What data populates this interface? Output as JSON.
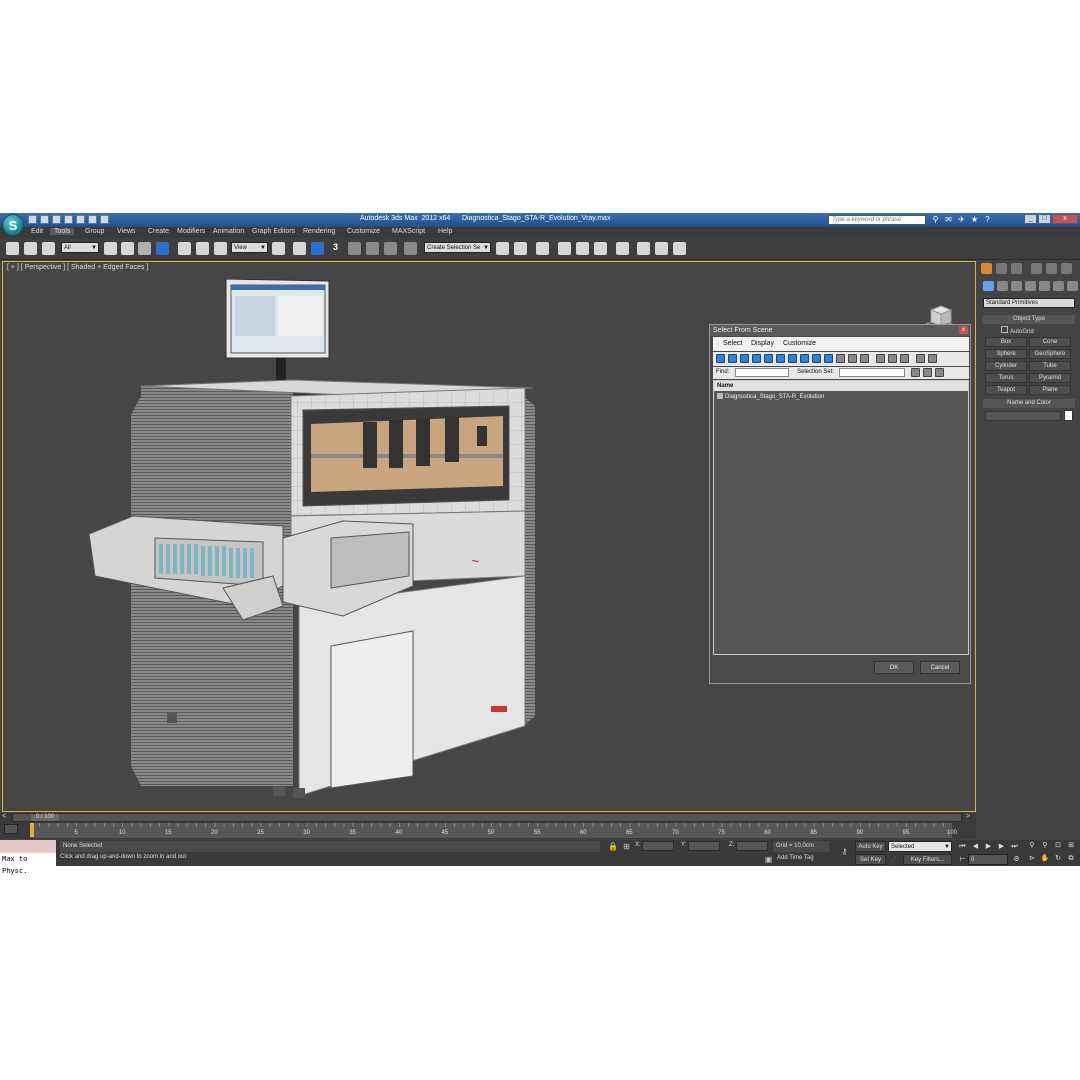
{
  "titlebar": {
    "app_logo_letter": "S",
    "title": "Autodesk 3ds Max  2012 x64      Diagnostica_Stago_STA-R_Evolution_Vray.max",
    "search_placeholder": "Type a keyword or phrase"
  },
  "menu": [
    "Edit",
    "Tools",
    "Group",
    "Views",
    "Create",
    "Modifiers",
    "Animation",
    "Graph Editors",
    "Rendering",
    "Customize",
    "MAXScript",
    "Help"
  ],
  "toolbar": {
    "selection_filter": "All",
    "reference_coord": "View",
    "snap_label": "3",
    "named_selection": "Create Selection Se"
  },
  "viewport": {
    "label": "[ + ] [ Perspective ] [ Shaded + Edged Faces ]"
  },
  "dialog": {
    "title": "Select From Scene",
    "close": "x",
    "menu": [
      "Select",
      "Display",
      "Customize"
    ],
    "find_label": "Find:",
    "selection_set_label": "Selection Set:",
    "list_header": "Name",
    "items": [
      "Diagnostica_Stago_STA-R_Evolution"
    ],
    "ok_label": "OK",
    "cancel_label": "Cancel"
  },
  "command_panel": {
    "primitive_type": "Standard Primitives",
    "object_type_title": "Object Type",
    "autogrid_label": "AutoGrid",
    "primitives": [
      "Box",
      "Cone",
      "Sphere",
      "GeoSphere",
      "Cylinder",
      "Tube",
      "Torus",
      "Pyramid",
      "Teapot",
      "Plane"
    ],
    "name_color_title": "Name and Color"
  },
  "timeline": {
    "slider_text": "0 / 100",
    "slider_left": "<",
    "slider_right": ">",
    "ticks": [
      "5",
      "10",
      "15",
      "20",
      "25",
      "30",
      "35",
      "40",
      "45",
      "50",
      "55",
      "60",
      "65",
      "70",
      "75",
      "80",
      "85",
      "90",
      "95",
      "100"
    ],
    "tick_values": [
      5,
      10,
      15,
      20,
      25,
      30,
      35,
      40,
      45,
      50,
      55,
      60,
      65,
      70,
      75,
      80,
      85,
      90,
      95,
      100
    ]
  },
  "statusbar": {
    "maxscript_text": "Max to Physc.",
    "selection_status": "None Selected",
    "prompt": "Click and drag up-and-down to zoom in and out",
    "x_label": "X:",
    "y_label": "Y:",
    "z_label": "Z:",
    "grid": "Grid = 10,0cm",
    "add_time_tag": "Add Time Tag",
    "auto_key": "Auto Key",
    "set_key": "Set Key",
    "key_mode": "Selected",
    "key_filters": "Key Filters...",
    "current_frame": "0"
  },
  "colors": {
    "viewport_border": "#d6b34a",
    "titlebar": "#2c5c9c",
    "accent_blue": "#2c6fcf"
  }
}
